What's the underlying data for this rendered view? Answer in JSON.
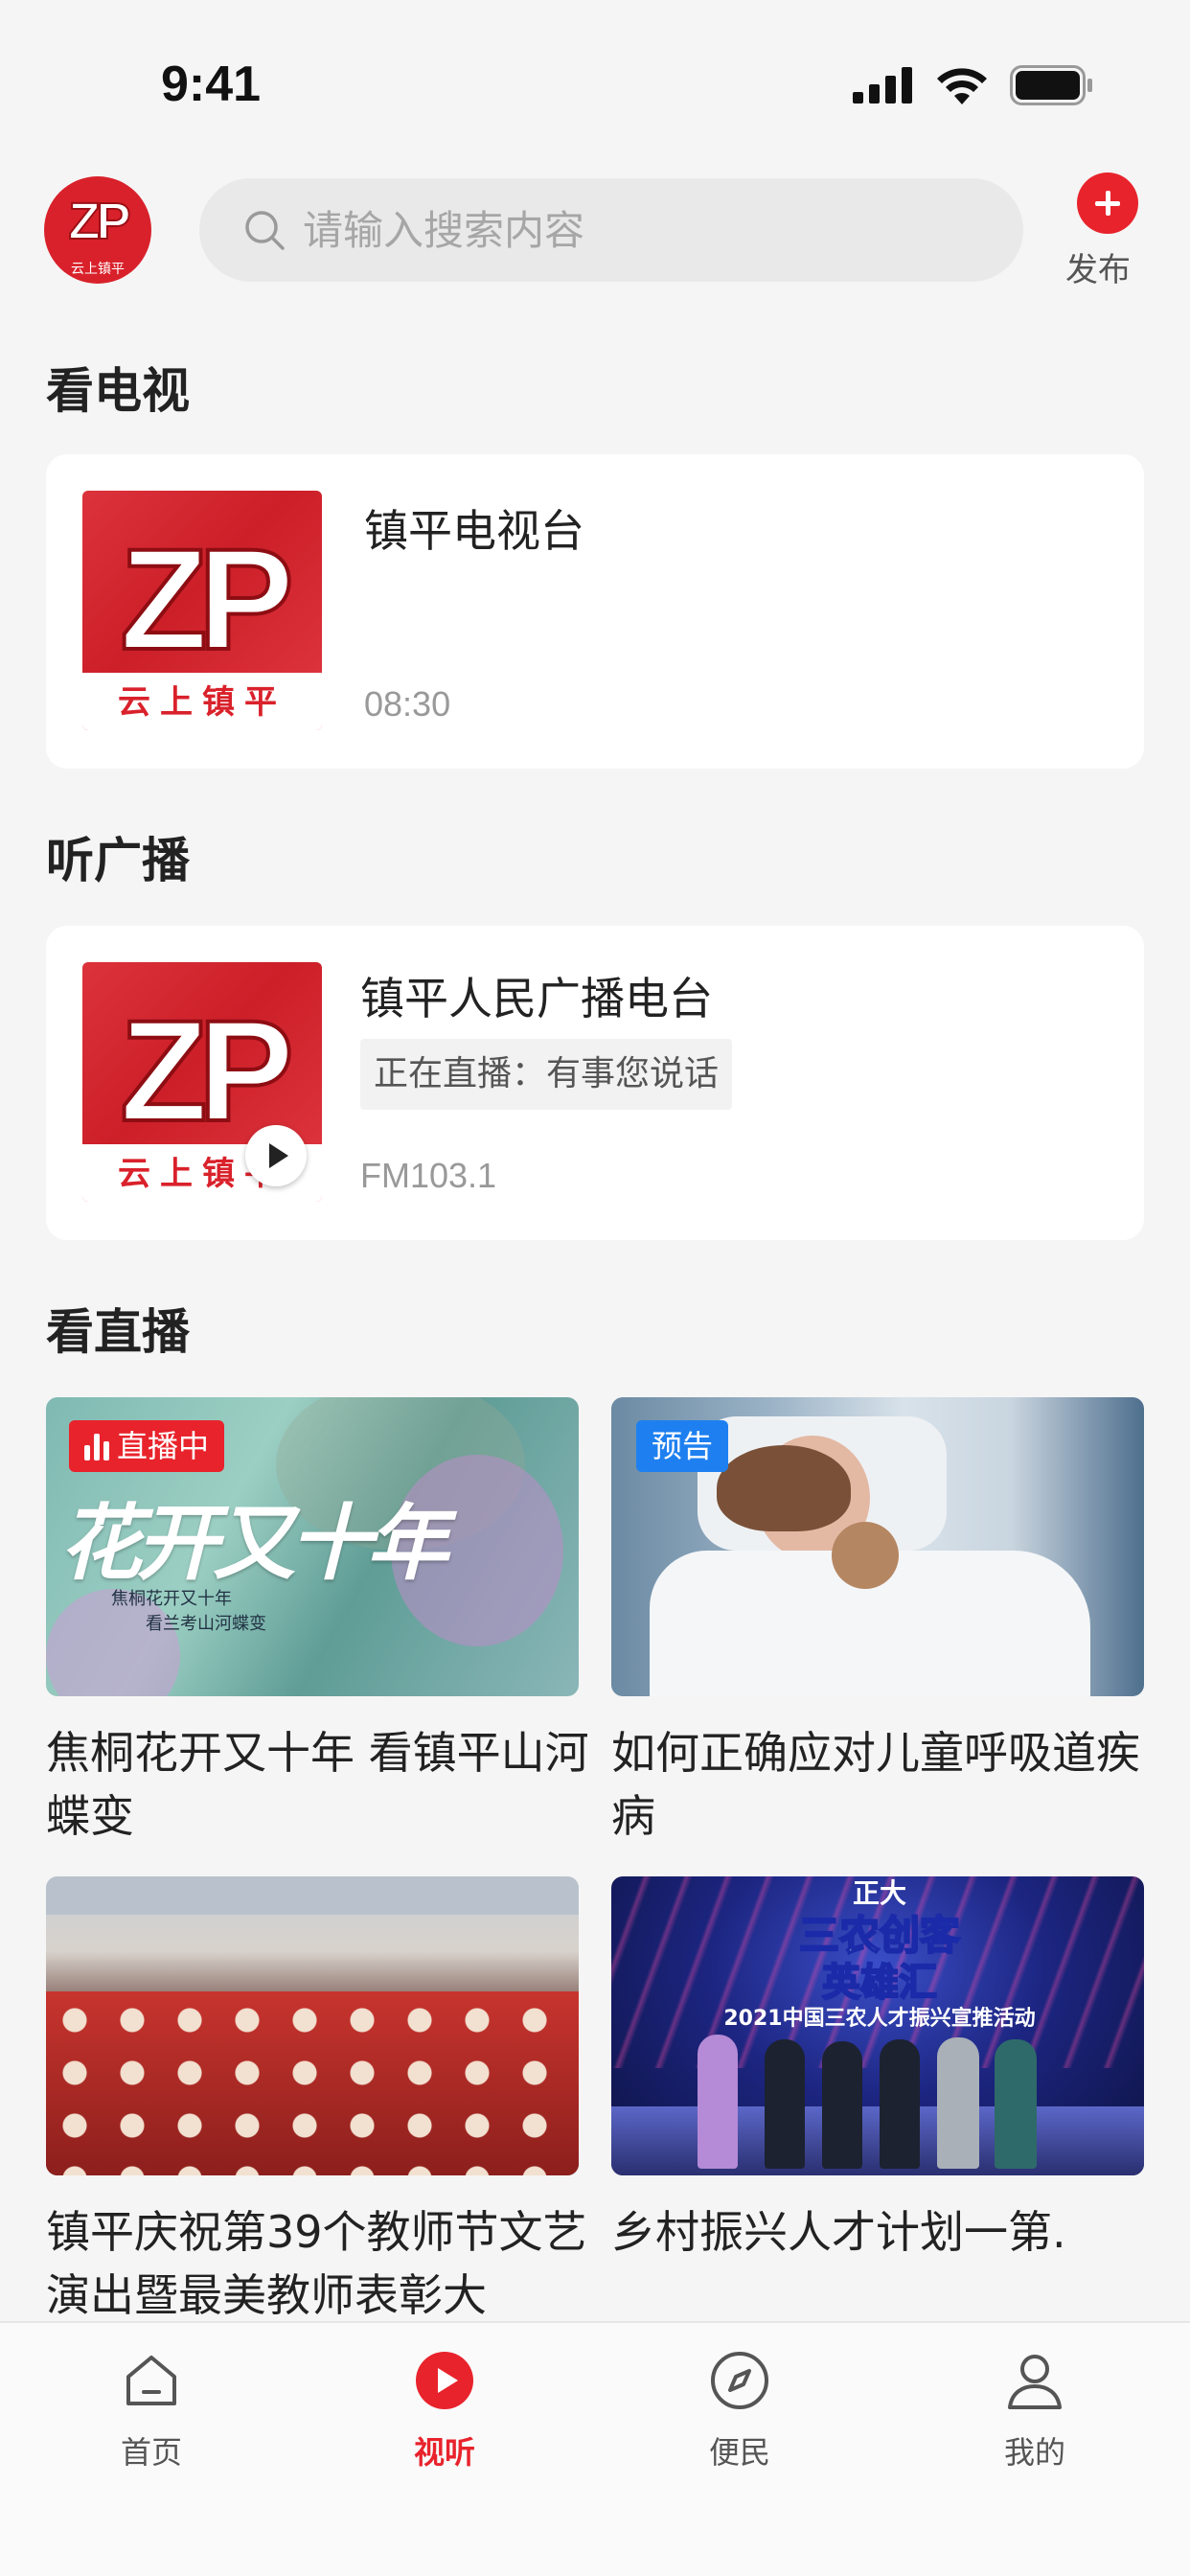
{
  "status_bar": {
    "time": "9:41"
  },
  "header": {
    "logo_text": "ZP",
    "logo_sub": "云上镇平",
    "search_placeholder": "请输入搜索内容",
    "publish_label": "发布"
  },
  "sections": {
    "tv_title": "看电视",
    "radio_title": "听广播",
    "live_title": "看直播"
  },
  "tv_card": {
    "thumb_text": "ZP",
    "thumb_sub": "云上镇平",
    "title": "镇平电视台",
    "time": "08:30"
  },
  "radio_card": {
    "thumb_text": "ZP",
    "thumb_sub": "云上镇平",
    "title": "镇平人民广播电台",
    "now_playing": "正在直播：有事您说话",
    "frequency": "FM103.1"
  },
  "live_items": [
    {
      "tag": "直播中",
      "title": "焦桐花开又十年 看镇平山河蝶变",
      "img_text": "花开又十年",
      "img_sub1": "焦桐花开又十年",
      "img_sub2": "看兰考山河蝶变"
    },
    {
      "tag": "预告",
      "title": "如何正确应对儿童呼吸道疾病"
    },
    {
      "tag": "",
      "title": "镇平庆祝第39个教师节文艺演出暨最美教师表彰大"
    },
    {
      "tag": "",
      "title": "乡村振兴人才计划一第.",
      "img_line1": "正大",
      "img_line2": "三农创客",
      "img_line3": "英雄汇",
      "img_line4": "2021中国三农人才振兴宣推活动"
    }
  ],
  "tabbar": {
    "items": [
      {
        "label": "首页",
        "icon": "home-icon"
      },
      {
        "label": "视听",
        "icon": "play-icon",
        "active": true
      },
      {
        "label": "便民",
        "icon": "compass-icon"
      },
      {
        "label": "我的",
        "icon": "user-icon"
      }
    ]
  },
  "colors": {
    "accent": "#e8232c",
    "preview": "#1e80f0",
    "background": "#f5f5f5"
  }
}
